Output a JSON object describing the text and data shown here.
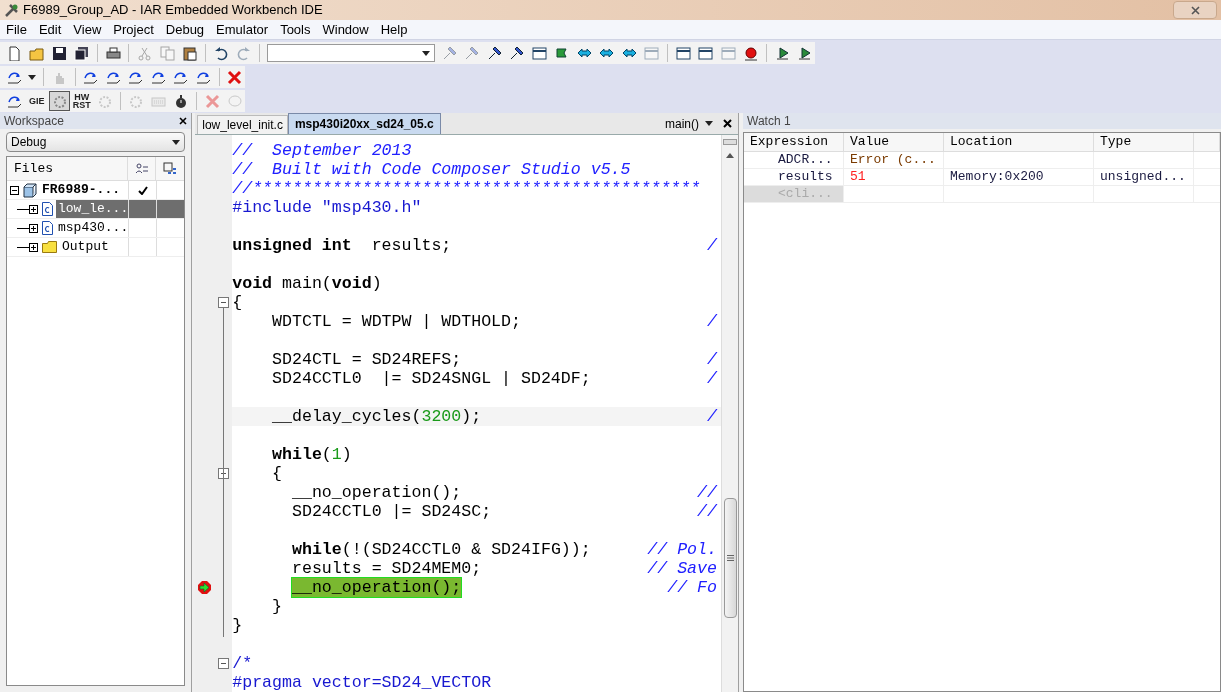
{
  "window": {
    "title": "F6989_Group_AD - IAR Embedded Workbench IDE"
  },
  "menu": [
    "File",
    "Edit",
    "View",
    "Project",
    "Debug",
    "Emulator",
    "Tools",
    "Window",
    "Help"
  ],
  "toolbars": [
    [
      {
        "kind": "button",
        "disabled": false
      },
      {
        "kind": "button",
        "disabled": false
      },
      {
        "kind": "button",
        "disabled": false
      },
      {
        "kind": "button",
        "disabled": false
      },
      {
        "kind": "separator"
      },
      {
        "kind": "button",
        "disabled": false
      },
      {
        "kind": "separator"
      },
      {
        "kind": "button",
        "disabled": true
      },
      {
        "kind": "button",
        "disabled": true
      },
      {
        "kind": "button",
        "disabled": false
      },
      {
        "kind": "separator"
      },
      {
        "kind": "button",
        "disabled": false
      },
      {
        "kind": "button",
        "disabled": true
      },
      {
        "kind": "separator"
      },
      {
        "kind": "combo"
      },
      {
        "kind": "button",
        "disabled": true
      },
      {
        "kind": "button",
        "disabled": true
      },
      {
        "kind": "button",
        "disabled": false
      },
      {
        "kind": "button",
        "disabled": false
      },
      {
        "kind": "button",
        "disabled": false
      },
      {
        "kind": "button",
        "disabled": false
      },
      {
        "kind": "button",
        "disabled": false
      },
      {
        "kind": "button",
        "disabled": false
      },
      {
        "kind": "button",
        "disabled": false
      },
      {
        "kind": "button",
        "disabled": true
      },
      {
        "kind": "separator"
      },
      {
        "kind": "button",
        "disabled": false
      },
      {
        "kind": "button",
        "disabled": false
      },
      {
        "kind": "button",
        "disabled": true
      },
      {
        "kind": "button",
        "disabled": false
      },
      {
        "kind": "separator"
      },
      {
        "kind": "button",
        "disabled": false
      },
      {
        "kind": "button",
        "disabled": false
      }
    ],
    [
      {
        "kind": "button",
        "disabled": false
      },
      {
        "kind": "dropdown"
      },
      {
        "kind": "separator"
      },
      {
        "kind": "button",
        "disabled": true
      },
      {
        "kind": "separator"
      },
      {
        "kind": "button",
        "disabled": false
      },
      {
        "kind": "button",
        "disabled": false
      },
      {
        "kind": "button",
        "disabled": false
      },
      {
        "kind": "button",
        "disabled": false
      },
      {
        "kind": "button",
        "disabled": false
      },
      {
        "kind": "button",
        "disabled": false
      },
      {
        "kind": "separator"
      },
      {
        "kind": "button",
        "disabled": false
      }
    ],
    [
      {
        "kind": "button",
        "disabled": false
      },
      {
        "kind": "text",
        "label": "GIE",
        "disabled": false
      },
      {
        "kind": "button",
        "disabled": false,
        "pressed": true
      },
      {
        "kind": "text",
        "label": "HW",
        "label2": "RST",
        "disabled": false
      },
      {
        "kind": "button",
        "disabled": true
      },
      {
        "kind": "separator"
      },
      {
        "kind": "button",
        "disabled": true
      },
      {
        "kind": "button",
        "disabled": true
      },
      {
        "kind": "button",
        "disabled": false
      },
      {
        "kind": "separator"
      },
      {
        "kind": "button",
        "disabled": true
      },
      {
        "kind": "button",
        "disabled": true
      }
    ]
  ],
  "workspace": {
    "title": "Workspace",
    "configuration": "Debug",
    "files_header": "Files",
    "tree": [
      {
        "label": "FR6989-...",
        "kind": "project",
        "expanded": true,
        "selected": false,
        "checked": true,
        "children": [
          {
            "label": "low_le...",
            "kind": "file",
            "expanded": false,
            "selected": true
          },
          {
            "label": "msp430...",
            "kind": "file",
            "expanded": false,
            "selected": false
          },
          {
            "label": "Output",
            "kind": "folder",
            "expanded": false,
            "selected": false
          }
        ]
      }
    ]
  },
  "editor": {
    "tabs": [
      {
        "label": "low_level_init.c",
        "selected": false
      },
      {
        "label": "msp430i20xx_sd24_05.c",
        "selected": true
      }
    ],
    "function": "main()",
    "lines": [
      {
        "tokens": [
          {
            "kind": "comment",
            "text": "//  September 2013"
          }
        ]
      },
      {
        "tokens": [
          {
            "kind": "comment",
            "text": "//  Built with Code Composer Studio v5.5"
          }
        ]
      },
      {
        "tokens": [
          {
            "kind": "comment",
            "text": "//*********************************************"
          }
        ]
      },
      {
        "tokens": [
          {
            "kind": "pre",
            "text": "#include \"msp430.h\""
          }
        ]
      },
      {
        "blank_before": true,
        "tokens": [
          {
            "kind": "kw",
            "text": "unsigned int"
          },
          {
            "kind": "plain",
            "text": "  results;"
          }
        ],
        "tail": "/"
      },
      {
        "blank_before": true,
        "tokens": [
          {
            "kind": "kw",
            "text": "void"
          },
          {
            "kind": "plain",
            "text": " main("
          },
          {
            "kind": "kw",
            "text": "void"
          },
          {
            "kind": "plain",
            "text": ")"
          }
        ]
      },
      {
        "tokens": [
          {
            "kind": "plain",
            "text": "{"
          }
        ],
        "fold": true
      },
      {
        "tokens": [
          {
            "kind": "plain",
            "text": "    WDTCTL = WDTPW | WDTHOLD;"
          }
        ],
        "tail": "/"
      },
      {
        "blank_before": true,
        "tokens": [
          {
            "kind": "plain",
            "text": "    SD24CTL = SD24REFS;"
          }
        ],
        "tail": "/"
      },
      {
        "tokens": [
          {
            "kind": "plain",
            "text": "    SD24CCTL0  |= SD24SNGL | SD24DF;"
          }
        ],
        "tail": "/"
      },
      {
        "blank_before": true,
        "tokens": [
          {
            "kind": "plain",
            "text": "    __delay_cycles("
          },
          {
            "kind": "num",
            "text": "3200"
          },
          {
            "kind": "plain",
            "text": ");"
          }
        ],
        "tail": "/",
        "cursor": true
      },
      {
        "blank_before": true,
        "tokens": [
          {
            "kind": "kw",
            "text": "    while"
          },
          {
            "kind": "plain",
            "text": "("
          },
          {
            "kind": "num",
            "text": "1"
          },
          {
            "kind": "plain",
            "text": ")"
          }
        ]
      },
      {
        "tokens": [
          {
            "kind": "plain",
            "text": "    {"
          }
        ],
        "fold": true
      },
      {
        "tokens": [
          {
            "kind": "plain",
            "text": "      __no_operation();"
          }
        ],
        "tail": "//"
      },
      {
        "tokens": [
          {
            "kind": "plain",
            "text": "      SD24CCTL0 |= SD24SC;"
          }
        ],
        "tail": "//"
      },
      {
        "blank_before": true,
        "tokens": [
          {
            "kind": "kw",
            "text": "      while"
          },
          {
            "kind": "plain",
            "text": "(!(SD24CCTL0 & SD24IFG));"
          }
        ],
        "tail": "// Pol."
      },
      {
        "tokens": [
          {
            "kind": "plain",
            "text": "      results = SD24MEM0;"
          }
        ],
        "tail": "// Save"
      },
      {
        "tokens": [
          {
            "kind": "current",
            "text": "      __no_operation();"
          }
        ],
        "tail": "// Fo",
        "breakpoint": true
      },
      {
        "tokens": [
          {
            "kind": "plain",
            "text": "    }"
          }
        ]
      },
      {
        "tokens": [
          {
            "kind": "plain",
            "text": "}"
          }
        ]
      },
      {
        "blank_before": true,
        "tokens": [
          {
            "kind": "pre",
            "text": "/*"
          }
        ],
        "fold": true
      },
      {
        "tokens": [
          {
            "kind": "pre",
            "text": "#pragma vector=SD24_VECTOR"
          }
        ]
      }
    ]
  },
  "watch": {
    "title": "Watch 1",
    "columns": [
      "Expression",
      "Value",
      "Location",
      "Type"
    ],
    "rows": [
      {
        "kind": "entry",
        "cells": [
          "ADCR...",
          "Error (c...",
          null,
          null
        ],
        "changed": false
      },
      {
        "kind": "entry",
        "cells": [
          "results",
          "51",
          "Memory:0x200",
          "unsigned..."
        ],
        "changed": true
      },
      {
        "kind": "placeholder",
        "cells": [
          "<cli..."
        ]
      }
    ]
  }
}
